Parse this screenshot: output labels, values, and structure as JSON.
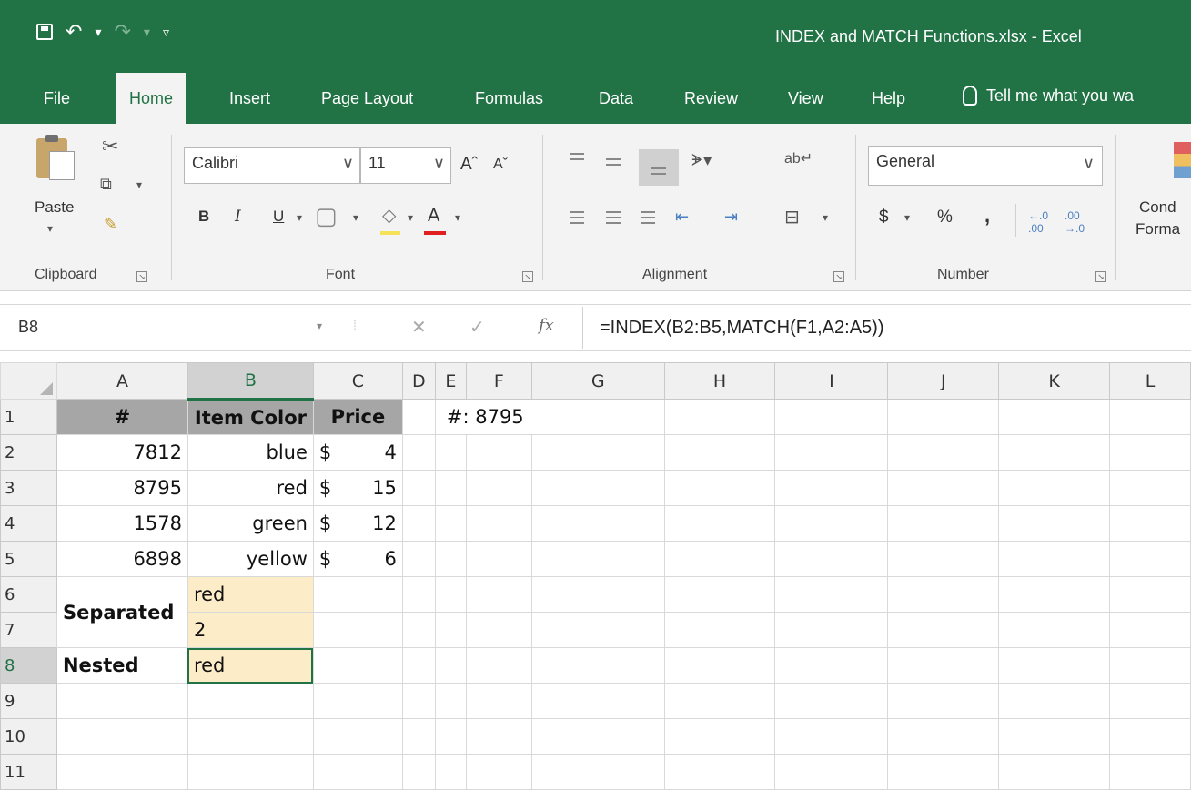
{
  "titlebar": {
    "title": "INDEX and MATCH Functions.xlsx  -  Excel"
  },
  "tabs": {
    "items": [
      "File",
      "Home",
      "Insert",
      "Page Layout",
      "Formulas",
      "Data",
      "Review",
      "View",
      "Help"
    ],
    "active": "Home",
    "tellme": "Tell me what you wa"
  },
  "ribbon": {
    "clipboard": {
      "paste_label": "Paste",
      "group_label": "Clipboard"
    },
    "font": {
      "name": "Calibri",
      "size": "11",
      "group_label": "Font",
      "bold": "B",
      "italic": "I",
      "underline": "U",
      "grow": "Aˆ",
      "shrink": "Aˇ",
      "color_letter": "A",
      "underline_color": "#e02020"
    },
    "alignment": {
      "group_label": "Alignment"
    },
    "number": {
      "format": "General",
      "currency": "$",
      "percent": "%",
      "comma": ",",
      "group_label": "Number"
    },
    "conditional": {
      "line1": "Cond",
      "line2": "Forma"
    }
  },
  "formula_bar": {
    "name_box": "B8",
    "fx": "fx",
    "formula": "=INDEX(B2:B5,MATCH(F1,A2:A5))"
  },
  "sheet": {
    "columns": [
      "A",
      "B",
      "C",
      "D",
      "E",
      "F",
      "G",
      "H",
      "I",
      "J",
      "K",
      "L"
    ],
    "selected_column": "B",
    "rows": [
      "1",
      "2",
      "3",
      "4",
      "5",
      "6",
      "7",
      "8",
      "9",
      "10",
      "11"
    ],
    "selected_row": "8",
    "header": {
      "a": "#",
      "b": "Item Color",
      "c": "Price"
    },
    "data": [
      {
        "id": "7812",
        "color": "blue",
        "cur": "$",
        "price": "4"
      },
      {
        "id": "8795",
        "color": "red",
        "cur": "$",
        "price": "15"
      },
      {
        "id": "1578",
        "color": "green",
        "cur": "$",
        "price": "12"
      },
      {
        "id": "6898",
        "color": "yellow",
        "cur": "$",
        "price": "6"
      }
    ],
    "lookup": {
      "label": "#:",
      "value": "8795"
    },
    "separated": {
      "label": "Separated",
      "row6": "red",
      "row7": "2"
    },
    "nested": {
      "label": "Nested",
      "value": "red"
    },
    "accent": "#217346",
    "highlight": "#fdecc8"
  }
}
